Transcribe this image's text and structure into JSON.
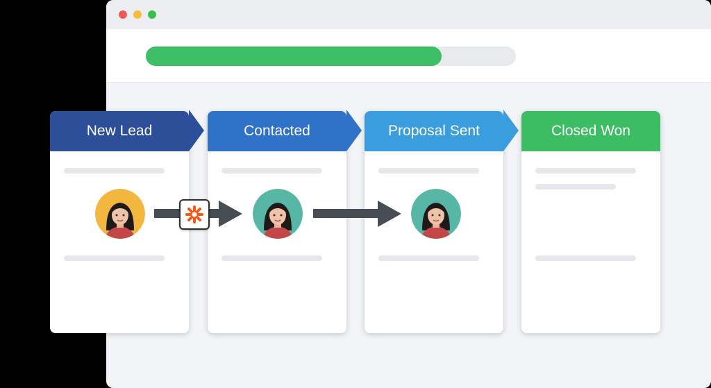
{
  "window": {
    "controls": [
      "close",
      "minimize",
      "maximize"
    ]
  },
  "progress": {
    "value": 0.8,
    "color": "#3fbe68"
  },
  "pipeline": {
    "stages": [
      {
        "label": "New Lead",
        "color": "#2d4f99"
      },
      {
        "label": "Contacted",
        "color": "#2f72c8"
      },
      {
        "label": "Proposal Sent",
        "color": "#3a9ede"
      },
      {
        "label": "Closed Won",
        "color": "#3dbd63"
      }
    ]
  },
  "integration": {
    "icon": "zapier-asterisk-icon",
    "color": "#f25a1a"
  },
  "avatars": [
    "avatar-woman-yellow-bg",
    "avatar-woman-teal-bg",
    "avatar-woman-teal-bg"
  ]
}
